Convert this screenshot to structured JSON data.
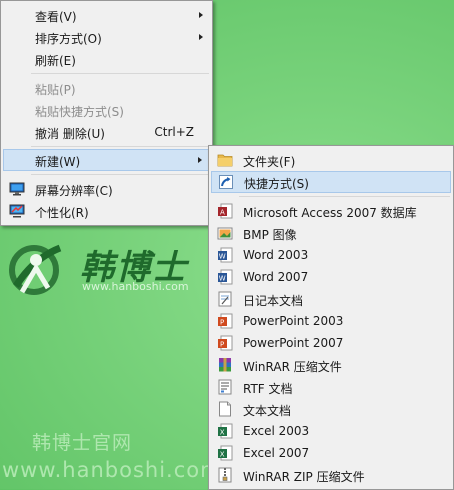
{
  "watermark": {
    "brand": "韩博士",
    "url": "www.hanboshi.com",
    "bottom_text": "韩博士官网",
    "bottom_url": "www.hanboshi.com"
  },
  "context_menu": {
    "items": [
      {
        "label": "查看(V)",
        "has_submenu": true
      },
      {
        "label": "排序方式(O)",
        "has_submenu": true
      },
      {
        "label": "刷新(E)"
      },
      {
        "label": "粘贴(P)",
        "disabled": true
      },
      {
        "label": "粘贴快捷方式(S)",
        "disabled": true
      },
      {
        "label": "撤消 删除(U)",
        "shortcut": "Ctrl+Z"
      },
      {
        "label": "新建(W)",
        "has_submenu": true,
        "highlighted": true
      },
      {
        "label": "屏幕分辨率(C)",
        "icon": "display-settings-icon"
      },
      {
        "label": "个性化(R)",
        "icon": "personalize-icon"
      }
    ]
  },
  "new_submenu": {
    "items": [
      {
        "label": "文件夹(F)",
        "icon": "folder-icon"
      },
      {
        "label": "快捷方式(S)",
        "icon": "shortcut-icon",
        "highlighted": true
      },
      {
        "label": "Microsoft Access 2007 数据库",
        "icon": "access-icon"
      },
      {
        "label": "BMP 图像",
        "icon": "bmp-icon"
      },
      {
        "label": "Word 2003",
        "icon": "word-icon"
      },
      {
        "label": "Word 2007",
        "icon": "word-icon"
      },
      {
        "label": "日记本文档",
        "icon": "journal-icon"
      },
      {
        "label": "PowerPoint 2003",
        "icon": "powerpoint-icon"
      },
      {
        "label": "PowerPoint 2007",
        "icon": "powerpoint-icon"
      },
      {
        "label": "WinRAR 压缩文件",
        "icon": "winrar-icon"
      },
      {
        "label": "RTF 文档",
        "icon": "rtf-icon"
      },
      {
        "label": "文本文档",
        "icon": "text-icon"
      },
      {
        "label": "Excel 2003",
        "icon": "excel-icon"
      },
      {
        "label": "Excel 2007",
        "icon": "excel-icon"
      },
      {
        "label": "WinRAR ZIP 压缩文件",
        "icon": "zip-icon"
      }
    ]
  },
  "colors": {
    "desktop": "#78d27b",
    "menu_bg": "#f0f0f0",
    "highlight": "#d0e3f5",
    "highlight_border": "#a8c8ea",
    "disabled_text": "#8d8d8d"
  }
}
